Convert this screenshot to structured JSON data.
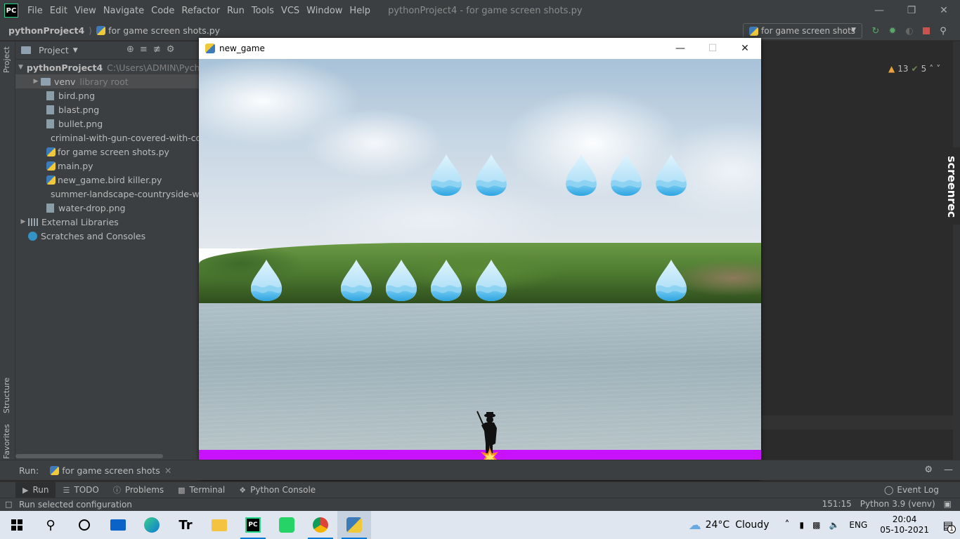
{
  "ide": {
    "menu": [
      "File",
      "Edit",
      "View",
      "Navigate",
      "Code",
      "Refactor",
      "Run",
      "Tools",
      "VCS",
      "Window",
      "Help"
    ],
    "window_title": "pythonProject4 - for game screen shots.py",
    "logo_text": "PC",
    "breadcrumb": {
      "project": "pythonProject4",
      "file": "for game screen shots.py"
    },
    "run_config": "for game screen shots"
  },
  "project_panel": {
    "title": "Project",
    "root": {
      "name": "pythonProject4",
      "path": "C:\\Users\\ADMIN\\Pycha"
    },
    "venv": {
      "name": "venv",
      "hint": "library root"
    },
    "files": [
      "bird.png",
      "blast.png",
      "bullet.png",
      "criminal-with-gun-covered-with-coat",
      "for game screen shots.py",
      "main.py",
      "new_game.bird killer.py",
      "summer-landscape-countryside-with-",
      "water-drop.png"
    ],
    "external_libraries": "External Libraries",
    "scratches": "Scratches and Consoles"
  },
  "side_tabs": {
    "project": "Project",
    "structure": "Structure",
    "favorites": "Favorites"
  },
  "inspections": {
    "warnings": "13",
    "ok": "5"
  },
  "screenrec": "screenrec",
  "game_window": {
    "title": "new_game",
    "ground_color": "#c811fd",
    "drops_row1_count": 5,
    "drops_row2_count": 6
  },
  "run_panel": {
    "label": "Run:",
    "tab": "for game screen shots"
  },
  "bottom_tabs": {
    "run": "Run",
    "todo": "TODO",
    "problems": "Problems",
    "terminal": "Terminal",
    "python_console": "Python Console",
    "event_log": "Event Log"
  },
  "status": {
    "message": "Run selected configuration",
    "position": "151:15",
    "interpreter": "Python 3.9 (venv)"
  },
  "taskbar": {
    "weather": {
      "temp": "24°C",
      "condition": "Cloudy"
    },
    "language": "ENG",
    "time": "20:04",
    "date": "05-10-2021",
    "notification_count": "1"
  }
}
